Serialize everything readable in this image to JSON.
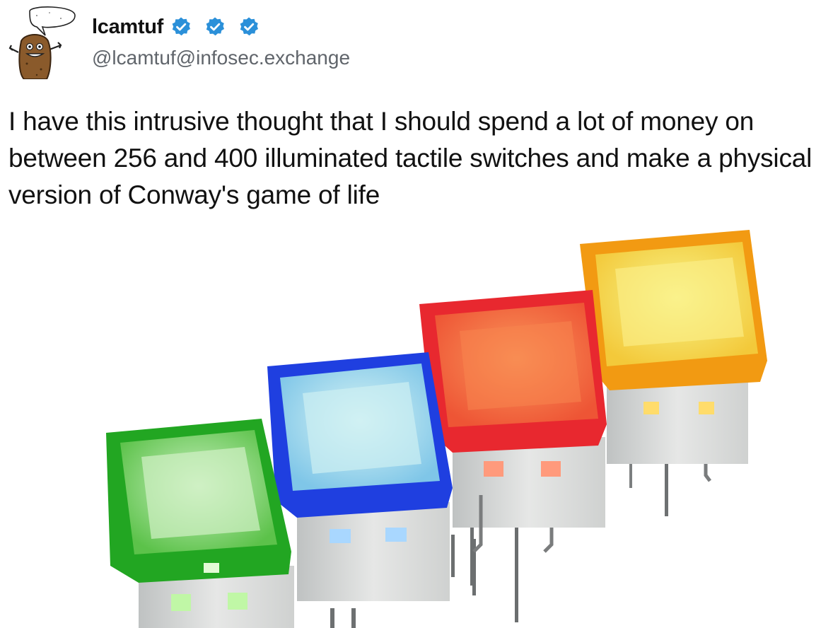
{
  "author": {
    "display_name": "lcamtuf",
    "handle": "@lcamtuf@infosec.exchange",
    "avatar_icon": "potato-character-avatar",
    "badges": [
      "verified-check-icon",
      "verified-check-icon",
      "verified-check-icon"
    ],
    "badge_color": "#2b90d9"
  },
  "post": {
    "text": "I have this intrusive thought that I should spend a lot of money on between 256 and 400 illuminated tactile switches and make a physical version of Conway's game of life"
  },
  "media": {
    "switch_colors": [
      "#22a622",
      "#1f3fe0",
      "#e8282f",
      "#f29a12"
    ]
  }
}
